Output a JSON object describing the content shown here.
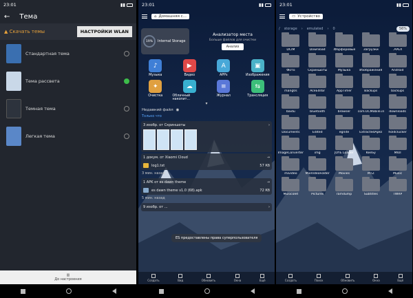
{
  "status": {
    "time": "23:01"
  },
  "screen1": {
    "title": "Тема",
    "download_label": "Скачать темы",
    "wlan_button": "НАСТРОЙКИ WLAN",
    "themes": [
      {
        "label": "Стандартная тема",
        "selected": false,
        "color": "#3a6fb0"
      },
      {
        "label": "Тема рассвета",
        "selected": true,
        "color": "#c9d8e8"
      },
      {
        "label": "Темная тема",
        "selected": false,
        "color": "#2d333d"
      },
      {
        "label": "Легкая тема",
        "selected": false,
        "color": "#5a87c8"
      }
    ],
    "footer": "До настроения"
  },
  "screen2": {
    "crumb": "Домашняя с...",
    "storage_label": "Internal Storage",
    "storage_pct": "19%",
    "analyzer_title": "Анализатор места",
    "analyzer_sub": "Больше файлов для очистки",
    "analyzer_button": "Анализ",
    "grid": [
      {
        "label": "Музыка",
        "icon": "♪",
        "color": "#3f7fd6"
      },
      {
        "label": "Видео",
        "icon": "▶",
        "color": "#e04848"
      },
      {
        "label": "APPs",
        "icon": "A",
        "color": "#48a8d8"
      },
      {
        "label": "Изображения",
        "icon": "▣",
        "color": "#4ab2c8"
      },
      {
        "label": "Очистка",
        "icon": "✦",
        "color": "#e0a040"
      },
      {
        "label": "Облачный накопит...",
        "icon": "☁",
        "color": "#38b0d0"
      },
      {
        "label": "Журнал",
        "icon": "≡",
        "color": "#5a78d8"
      },
      {
        "label": "Трансляция",
        "icon": "⇆",
        "color": "#3cbf7a"
      }
    ],
    "recent_title": "Недавний файл",
    "only_label": "Только что",
    "card1": "3 изобр. от Скриншоты",
    "card2": "1 докум. от Xiaomi Cloud",
    "file1": "log1.txt",
    "file1_size": "57 Кб",
    "section2": "3 мин. назад",
    "card3": "1 APK от es dawn theme",
    "file2": "es dawn theme v1.0 (68).apk",
    "file2_size": "72 Кб",
    "section3": "5 мин. назад",
    "card4": "9 изобр. от ...",
    "toast": "ES предоставлены права суперпользователя",
    "bottom": [
      "Создать",
      "Вид",
      "Обновить",
      "Окна",
      "Ещё"
    ]
  },
  "screen3": {
    "crumb": "Устройство",
    "path": [
      "/",
      "storage",
      "emulated",
      "0"
    ],
    "percent": "56%",
    "folders": [
      "DCIM",
      "Download",
      ".Фарфоровые",
      "Загрузки",
      ".APEX",
      "Фото",
      "Скриншоты",
      "Музыка",
      "Изображения",
      "Android",
      "mang0s",
      "AceEditor",
      "AppTimer",
      "Backups",
      "backups",
      "baidu",
      "bluetooth",
      "browser",
      "com.UCMobile.intl",
      "downloads",
      "Documents",
      "Edited",
      "egnite",
      "ExtractedApks",
      "holdclucker",
      "ImageConverter",
      "img",
      "JOYE Loader",
      "KeeSy",
      "MIUI",
      "mivideo",
      "MixVideoFolder",
      "Movies",
      "MTZ",
      "Music",
      "Musicolet",
      "Pictures",
      "ramdump",
      "Subtitles",
      "TWRP"
    ],
    "bottom": [
      "Создать",
      "Поиск",
      "Обновить",
      "Окна",
      "Ещё"
    ]
  }
}
